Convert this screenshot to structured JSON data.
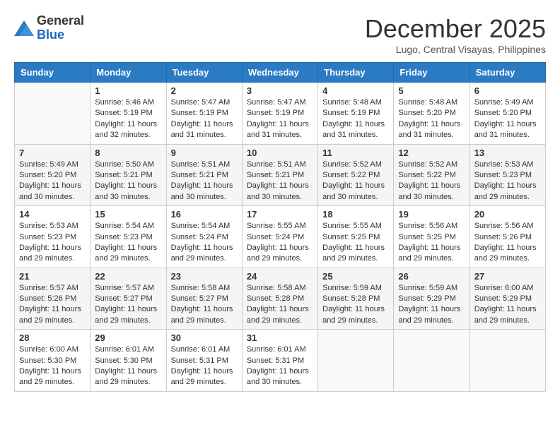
{
  "header": {
    "logo": {
      "general": "General",
      "blue": "Blue"
    },
    "title": "December 2025",
    "location": "Lugo, Central Visayas, Philippines"
  },
  "calendar": {
    "days_of_week": [
      "Sunday",
      "Monday",
      "Tuesday",
      "Wednesday",
      "Thursday",
      "Friday",
      "Saturday"
    ],
    "weeks": [
      [
        {
          "day": "",
          "info": ""
        },
        {
          "day": "1",
          "info": "Sunrise: 5:46 AM\nSunset: 5:19 PM\nDaylight: 11 hours\nand 32 minutes."
        },
        {
          "day": "2",
          "info": "Sunrise: 5:47 AM\nSunset: 5:19 PM\nDaylight: 11 hours\nand 31 minutes."
        },
        {
          "day": "3",
          "info": "Sunrise: 5:47 AM\nSunset: 5:19 PM\nDaylight: 11 hours\nand 31 minutes."
        },
        {
          "day": "4",
          "info": "Sunrise: 5:48 AM\nSunset: 5:19 PM\nDaylight: 11 hours\nand 31 minutes."
        },
        {
          "day": "5",
          "info": "Sunrise: 5:48 AM\nSunset: 5:20 PM\nDaylight: 11 hours\nand 31 minutes."
        },
        {
          "day": "6",
          "info": "Sunrise: 5:49 AM\nSunset: 5:20 PM\nDaylight: 11 hours\nand 31 minutes."
        }
      ],
      [
        {
          "day": "7",
          "info": "Sunrise: 5:49 AM\nSunset: 5:20 PM\nDaylight: 11 hours\nand 30 minutes."
        },
        {
          "day": "8",
          "info": "Sunrise: 5:50 AM\nSunset: 5:21 PM\nDaylight: 11 hours\nand 30 minutes."
        },
        {
          "day": "9",
          "info": "Sunrise: 5:51 AM\nSunset: 5:21 PM\nDaylight: 11 hours\nand 30 minutes."
        },
        {
          "day": "10",
          "info": "Sunrise: 5:51 AM\nSunset: 5:21 PM\nDaylight: 11 hours\nand 30 minutes."
        },
        {
          "day": "11",
          "info": "Sunrise: 5:52 AM\nSunset: 5:22 PM\nDaylight: 11 hours\nand 30 minutes."
        },
        {
          "day": "12",
          "info": "Sunrise: 5:52 AM\nSunset: 5:22 PM\nDaylight: 11 hours\nand 30 minutes."
        },
        {
          "day": "13",
          "info": "Sunrise: 5:53 AM\nSunset: 5:23 PM\nDaylight: 11 hours\nand 29 minutes."
        }
      ],
      [
        {
          "day": "14",
          "info": "Sunrise: 5:53 AM\nSunset: 5:23 PM\nDaylight: 11 hours\nand 29 minutes."
        },
        {
          "day": "15",
          "info": "Sunrise: 5:54 AM\nSunset: 5:23 PM\nDaylight: 11 hours\nand 29 minutes."
        },
        {
          "day": "16",
          "info": "Sunrise: 5:54 AM\nSunset: 5:24 PM\nDaylight: 11 hours\nand 29 minutes."
        },
        {
          "day": "17",
          "info": "Sunrise: 5:55 AM\nSunset: 5:24 PM\nDaylight: 11 hours\nand 29 minutes."
        },
        {
          "day": "18",
          "info": "Sunrise: 5:55 AM\nSunset: 5:25 PM\nDaylight: 11 hours\nand 29 minutes."
        },
        {
          "day": "19",
          "info": "Sunrise: 5:56 AM\nSunset: 5:25 PM\nDaylight: 11 hours\nand 29 minutes."
        },
        {
          "day": "20",
          "info": "Sunrise: 5:56 AM\nSunset: 5:26 PM\nDaylight: 11 hours\nand 29 minutes."
        }
      ],
      [
        {
          "day": "21",
          "info": "Sunrise: 5:57 AM\nSunset: 5:26 PM\nDaylight: 11 hours\nand 29 minutes."
        },
        {
          "day": "22",
          "info": "Sunrise: 5:57 AM\nSunset: 5:27 PM\nDaylight: 11 hours\nand 29 minutes."
        },
        {
          "day": "23",
          "info": "Sunrise: 5:58 AM\nSunset: 5:27 PM\nDaylight: 11 hours\nand 29 minutes."
        },
        {
          "day": "24",
          "info": "Sunrise: 5:58 AM\nSunset: 5:28 PM\nDaylight: 11 hours\nand 29 minutes."
        },
        {
          "day": "25",
          "info": "Sunrise: 5:59 AM\nSunset: 5:28 PM\nDaylight: 11 hours\nand 29 minutes."
        },
        {
          "day": "26",
          "info": "Sunrise: 5:59 AM\nSunset: 5:29 PM\nDaylight: 11 hours\nand 29 minutes."
        },
        {
          "day": "27",
          "info": "Sunrise: 6:00 AM\nSunset: 5:29 PM\nDaylight: 11 hours\nand 29 minutes."
        }
      ],
      [
        {
          "day": "28",
          "info": "Sunrise: 6:00 AM\nSunset: 5:30 PM\nDaylight: 11 hours\nand 29 minutes."
        },
        {
          "day": "29",
          "info": "Sunrise: 6:01 AM\nSunset: 5:30 PM\nDaylight: 11 hours\nand 29 minutes."
        },
        {
          "day": "30",
          "info": "Sunrise: 6:01 AM\nSunset: 5:31 PM\nDaylight: 11 hours\nand 29 minutes."
        },
        {
          "day": "31",
          "info": "Sunrise: 6:01 AM\nSunset: 5:31 PM\nDaylight: 11 hours\nand 30 minutes."
        },
        {
          "day": "",
          "info": ""
        },
        {
          "day": "",
          "info": ""
        },
        {
          "day": "",
          "info": ""
        }
      ]
    ]
  }
}
